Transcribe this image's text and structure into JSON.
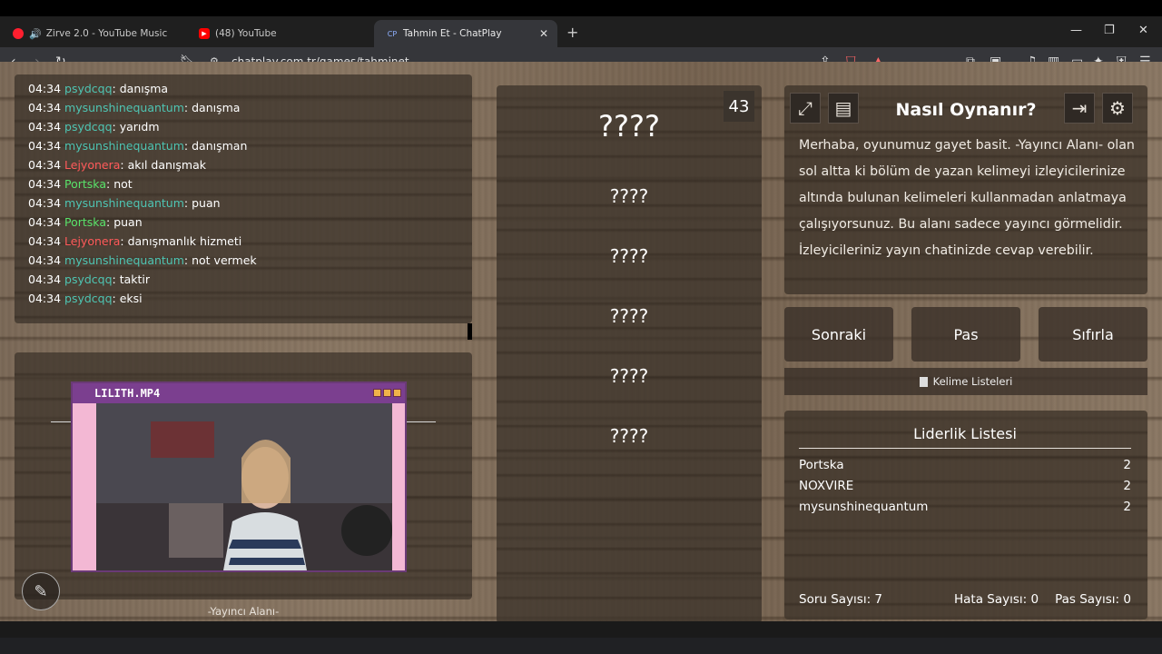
{
  "tabs": [
    {
      "title": "Zirve 2.0 - YouTube Music",
      "favicon_color": "#ff1f2f"
    },
    {
      "title": "(48) YouTube",
      "favicon_color": "#ff0000"
    },
    {
      "title": "Tahmin Et - ChatPlay",
      "favicon_color": "#3a6fd8",
      "favicon_text": "CP"
    }
  ],
  "url": "chatplay.com.tr/games/tahminet",
  "chat": [
    {
      "time": "04:34",
      "user": "psydcqq",
      "color": "teal",
      "msg": "danışma"
    },
    {
      "time": "04:34",
      "user": "mysunshinequantum",
      "color": "teal",
      "msg": "danışma"
    },
    {
      "time": "04:34",
      "user": "psydcqq",
      "color": "teal",
      "msg": "yarıdm"
    },
    {
      "time": "04:34",
      "user": "mysunshinequantum",
      "color": "teal",
      "msg": "danışman"
    },
    {
      "time": "04:34",
      "user": "Lejyonera",
      "color": "red",
      "msg": "akıl danışmak"
    },
    {
      "time": "04:34",
      "user": "Portska",
      "color": "green",
      "msg": "not"
    },
    {
      "time": "04:34",
      "user": "mysunshinequantum",
      "color": "teal",
      "msg": "puan"
    },
    {
      "time": "04:34",
      "user": "Portska",
      "color": "green",
      "msg": "puan"
    },
    {
      "time": "04:34",
      "user": "Lejyonera",
      "color": "red",
      "msg": "danışmanlık hizmeti"
    },
    {
      "time": "04:34",
      "user": "mysunshinequantum",
      "color": "teal",
      "msg": "not vermek"
    },
    {
      "time": "04:34",
      "user": "psydcqq",
      "color": "teal",
      "msg": "taktir"
    },
    {
      "time": "04:34",
      "user": "psydcqq",
      "color": "teal",
      "msg": "eksi"
    }
  ],
  "streamer": {
    "cam_title": "LILITH.MP4",
    "area_label": "-Yayıncı Alanı-"
  },
  "words": {
    "counter": "43",
    "items": [
      "????",
      "????",
      "????",
      "????",
      "????",
      "????"
    ]
  },
  "info": {
    "title": "Nasıl Oynanır?",
    "text": "Merhaba, oyunumuz gayet basit. -Yayıncı Alanı- olan sol altta ki bölüm de yazan kelimeyi izleyicilerinize altında bulunan kelimeleri kullanmadan anlatmaya çalışıyorsunuz. Bu alanı sadece yayıncı görmelidir. İzleyicileriniz yayın chatinizde cevap verebilir."
  },
  "buttons": {
    "next": "Sonraki",
    "pass": "Pas",
    "reset": "Sıfırla",
    "word_lists": "Kelime Listeleri"
  },
  "leaderboard": {
    "title": "Liderlik Listesi",
    "rows": [
      {
        "name": "Portska",
        "score": "2"
      },
      {
        "name": "NOXVIRE",
        "score": "2"
      },
      {
        "name": "mysunshinequantum",
        "score": "2"
      }
    ],
    "stats": {
      "questions": "Soru Sayısı: 7",
      "errors": "Hata Sayısı: 0",
      "passes": "Pas Sayısı: 0"
    }
  },
  "colors": {
    "teal": "#4ec5b3",
    "red": "#ff5a5a",
    "green": "#59e36a"
  }
}
